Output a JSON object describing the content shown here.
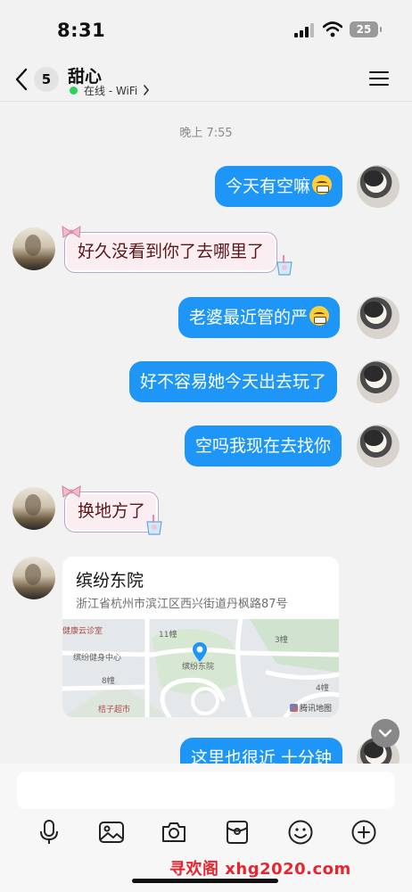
{
  "status_bar": {
    "time": "8:31",
    "battery": "25"
  },
  "header": {
    "unread_count": "5",
    "contact_name": "甜心",
    "online_status": "在线 - WiFi"
  },
  "timestamp": "晚上 7:55",
  "messages": [
    {
      "side": "out",
      "text": "今天有空嘛",
      "emoji": "grin-emoji"
    },
    {
      "side": "in",
      "text": "好久没看到你了去哪里了"
    },
    {
      "side": "out",
      "text": "老婆最近管的严",
      "emoji": "smirk-emoji"
    },
    {
      "side": "out",
      "text": "好不容易她今天出去玩了"
    },
    {
      "side": "out",
      "text": "空吗我现在去找你"
    },
    {
      "side": "in",
      "text": "换地方了"
    },
    {
      "side": "out",
      "text": "这里也很近 十分钟"
    }
  ],
  "location_card": {
    "name": "缤纷东院",
    "address": "浙江省杭州市滨江区西兴街道丹枫路87号",
    "map_labels": {
      "clinic": "健康云诊室",
      "building_11": "11幢",
      "building_3": "3幢",
      "gym": "缤纷健身中心",
      "poi": "缤纷东院",
      "building_8": "8幢",
      "building_4": "4幢",
      "supermarket": "桔子超市"
    },
    "map_brand": "腾讯地图"
  },
  "input": {
    "placeholder": ""
  },
  "toolbar": {
    "icons": [
      "microphone-icon",
      "image-icon",
      "camera-icon",
      "red-packet-icon",
      "emoji-icon",
      "plus-icon"
    ]
  },
  "watermark": "寻欢阁 xhg2020.com",
  "colors": {
    "accent": "#1e96f7",
    "online": "#2ed15b",
    "incoming_bubble": "#fbeef2"
  }
}
